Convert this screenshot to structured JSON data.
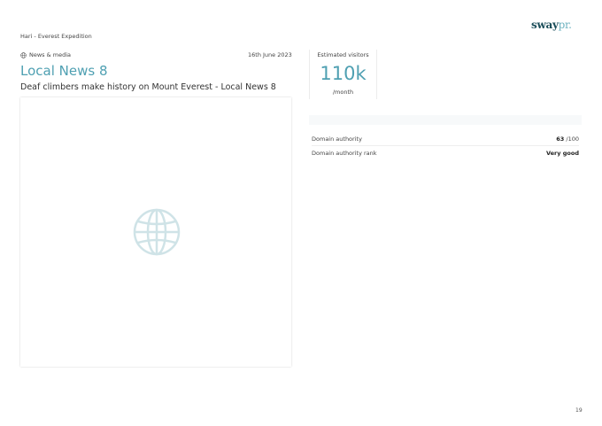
{
  "brand": {
    "logo_main": "sway",
    "logo_accent": "pr."
  },
  "breadcrumb": "Hari - Everest Expedition",
  "article": {
    "category": "News & media",
    "category_icon": "globe-icon",
    "date": "16th June 2023",
    "outlet": "Local News 8",
    "headline": "Deaf climbers make history on Mount Everest - Local News 8",
    "preview_icon": "globe-icon"
  },
  "visitors": {
    "label": "Estimated visitors",
    "value": "110k",
    "unit": "/month"
  },
  "metrics": [
    {
      "label": "Domain authority",
      "value": "63",
      "suffix": " /100"
    },
    {
      "label": "Domain authority rank",
      "value": "Very good",
      "suffix": ""
    }
  ],
  "page_number": "19",
  "colors": {
    "accent": "#4fa0b2",
    "icon": "#cfe3e7",
    "brand_dark": "#1c4e5a"
  }
}
